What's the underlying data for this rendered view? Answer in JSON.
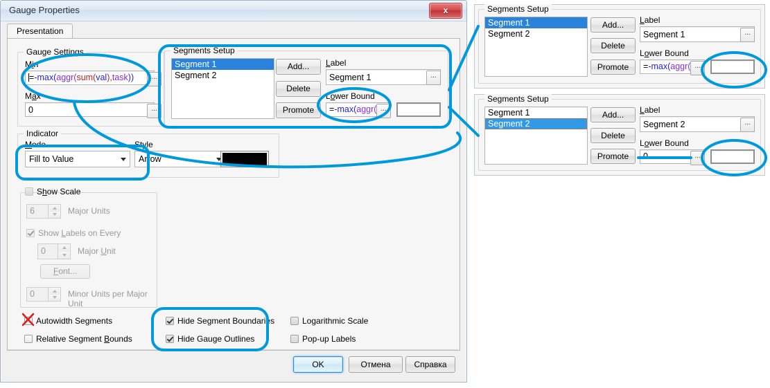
{
  "window": {
    "title": "Gauge Properties",
    "close_label": "x"
  },
  "tabs": [
    {
      "label": "Presentation"
    }
  ],
  "gauge_settings": {
    "group_label": "Gauge Settings",
    "min_label": "Min",
    "min_value": "=-max(aggr(sum(val),task))",
    "min_parts": {
      "eq": "=",
      "blue1": "-max(",
      "purple1": "aggr(",
      "red1": "sum(",
      "blue2": "val",
      "red2": "),",
      "purple2": "task",
      "blue3": "))"
    },
    "max_label": "Max",
    "max_value": "0",
    "ellipsis_label": "..."
  },
  "segments_setup": {
    "group_label": "Segments Setup",
    "items": [
      "Segment 1",
      "Segment 2"
    ],
    "selected_index": 0,
    "add_button": "Add...",
    "delete_button": "Delete",
    "promote_button": "Promote",
    "label_caption": "Label",
    "label_value": "Segment 1",
    "lower_bound_caption": "Lower Bound",
    "lower_bound_value": "=-max(aggr(s",
    "lower_bound_parts": {
      "eq": "=",
      "blue": "-max(",
      "purple": "aggr(",
      "red": "s"
    },
    "ellipsis_label": "..."
  },
  "indicator": {
    "group_label": "Indicator",
    "mode_label": "Mode",
    "mode_value": "Fill to Value",
    "style_label": "Style",
    "style_value": "Arrow",
    "color": "#000000"
  },
  "scale": {
    "show_scale_label": "Show Scale",
    "show_scale_checked": false,
    "major_units_value": "6",
    "major_units_label": "Major Units",
    "show_labels_label": "Show Labels on Every",
    "show_labels_checked": true,
    "major_unit_value": "0",
    "major_unit_label": "Major Unit",
    "font_button": "Font...",
    "minor_units_value": "0",
    "minor_units_label": "Minor Units per Major Unit"
  },
  "checkboxes": {
    "autowidth_segments": {
      "label": "Autowidth Segments",
      "checked": false,
      "marked_x": true
    },
    "relative_segment_bounds": {
      "label": "Relative Segment Bounds",
      "checked": false
    },
    "hide_segment_boundaries": {
      "label": "Hide Segment Boundaries",
      "checked": true
    },
    "hide_gauge_outlines": {
      "label": "Hide Gauge Outlines",
      "checked": true
    },
    "logarithmic_scale": {
      "label": "Logarithmic Scale",
      "checked": false
    },
    "popup_labels": {
      "label": "Pop-up Labels",
      "checked": false
    }
  },
  "footer": {
    "ok": "OK",
    "cancel": "Отмена",
    "help": "Справка"
  },
  "right_panels": [
    {
      "group_label": "Segments Setup",
      "items": [
        "Segment 1",
        "Segment 2"
      ],
      "selected_index": 0,
      "selection_style": "active",
      "add_button": "Add...",
      "delete_button": "Delete",
      "promote_button": "Promote",
      "label_caption": "Label",
      "label_value": "Segment 1",
      "lower_bound_caption": "Lower Bound",
      "lower_bound_value": "=-max(aggr(s",
      "lower_bound_parts": {
        "eq": "=",
        "blue": "-max(",
        "purple": "aggr(",
        "red": "s"
      },
      "extra_box_value": "",
      "ellipsis_label": "..."
    },
    {
      "group_label": "Segments Setup",
      "items": [
        "Segment 1",
        "Segment 2"
      ],
      "selected_index": 1,
      "selection_style": "inactive",
      "add_button": "Add...",
      "delete_button": "Delete",
      "promote_button": "Promote",
      "label_caption": "Label",
      "label_value": "Segment 2",
      "lower_bound_caption": "Lower Bound",
      "lower_bound_value": "0",
      "lower_bound_parts": {
        "eq": "",
        "blue": "",
        "purple": "",
        "red": ""
      },
      "extra_box_value": "",
      "ellipsis_label": "..."
    }
  ],
  "annotations": {
    "highlight_color": "#0099dd",
    "x_mark_color": "#e01b1b",
    "x_mark_label": "X"
  }
}
